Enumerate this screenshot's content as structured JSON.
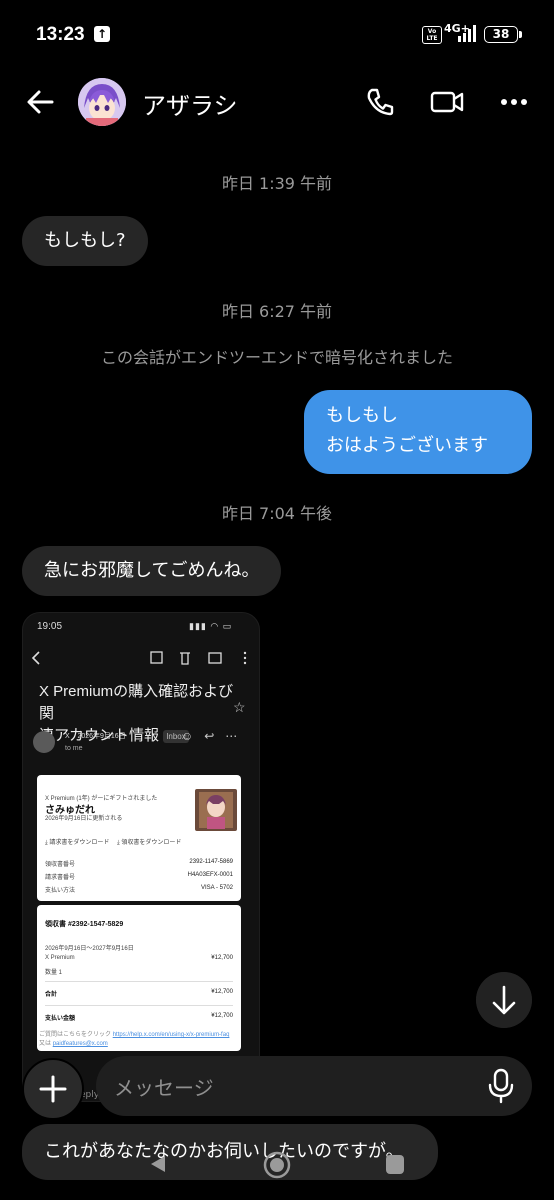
{
  "status_bar": {
    "time": "13:23",
    "volte": "Vo LTE",
    "network": "4G+",
    "battery": "38"
  },
  "header": {
    "contact_name": "アザラシ"
  },
  "messages": {
    "ts1": "昨日 1:39 午前",
    "msg1": "もしもし?",
    "ts2": "昨日 6:27 午前",
    "e2e_notice": "この会話がエンドツーエンドで暗号化されました",
    "msg2_line1": "もしもし",
    "msg2_line2": "おはようございます",
    "ts3": "昨日 7:04 午後",
    "msg3": "急にお邪魔してごめんね。",
    "msg4": "これがあなたなのかお伺いしたいのですが。"
  },
  "shared_image": {
    "time": "19:05",
    "subject_line1": "X Premiumの購入確認および関",
    "subject_line2": "連アカウント情報",
    "inbox_label": "Inbox",
    "sender": "X",
    "sent_date": "2026年9月16日",
    "to": "to me",
    "gift_text": "X Premium (1年) がーにギフトされました",
    "gift_name": "さみゅだれ",
    "gift_date": "2026年9月16日に更新される",
    "dl_receipt": "請求書をダウンロード",
    "dl_invoice": "領収書をダウンロード",
    "row1_label": "領収書番号",
    "row1_value": "2392-1147-5869",
    "row2_label": "請求書番号",
    "row2_value": "H4A03EFX-0001",
    "row3_label": "支払い方法",
    "row3_value": "VISA  - 5702",
    "receipt_title": "領収書 #2392-1547-5829",
    "period": "2026年9月16日〜2027年9月16日",
    "item_name": "X Premium",
    "item_price": "¥12,700",
    "qty": "数量 1",
    "total_label": "合計",
    "total_value": "¥12,700",
    "paid_label": "支払い金額",
    "paid_value": "¥12,700",
    "footer_prefix": "ご質問はこちらをクリック",
    "footer_link1": "https://help.x.com/en/using-x/x-premium-faq",
    "footer_mid": "又は",
    "footer_link2": "paidfeatures@x.com",
    "reply_fragment": "eply"
  },
  "composer": {
    "placeholder": "メッセージ"
  },
  "colors": {
    "background": "#000000",
    "incoming_bubble": "#262626",
    "outgoing_bubble": "#3f93e8",
    "meta_text": "#9a9a9a"
  }
}
